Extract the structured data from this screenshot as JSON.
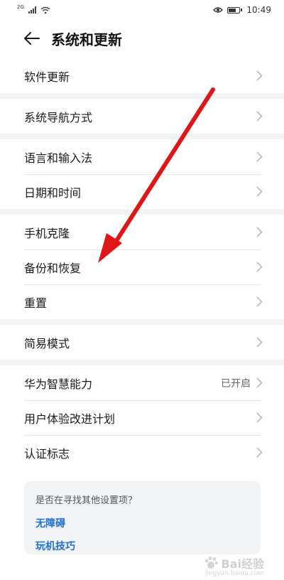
{
  "status_bar": {
    "network_tag": "2G",
    "time": "10:49"
  },
  "header": {
    "title": "系统和更新"
  },
  "groups": [
    [
      {
        "label": "软件更新"
      }
    ],
    [
      {
        "label": "系统导航方式"
      }
    ],
    [
      {
        "label": "语言和输入法"
      },
      {
        "label": "日期和时间"
      }
    ],
    [
      {
        "label": "手机克隆"
      },
      {
        "label": "备份和恢复"
      },
      {
        "label": "重置"
      }
    ],
    [
      {
        "label": "简易模式"
      }
    ],
    [
      {
        "label": "华为智慧能力",
        "value": "已开启"
      },
      {
        "label": "用户体验改进计划"
      },
      {
        "label": "认证标志"
      }
    ]
  ],
  "suggestion": {
    "question": "是否在寻找其他设置项？",
    "links": [
      "无障碍",
      "玩机技巧"
    ]
  },
  "watermark": {
    "brand": "Bai经验",
    "sub": "jingyan.baidu.com"
  },
  "colors": {
    "accent": "#1f6fd1",
    "arrow": "#e01515",
    "group_gap": "#f1f3f5"
  },
  "icons": {
    "back": "arrow-left-icon",
    "row_chevron": "chevron-right-icon"
  }
}
